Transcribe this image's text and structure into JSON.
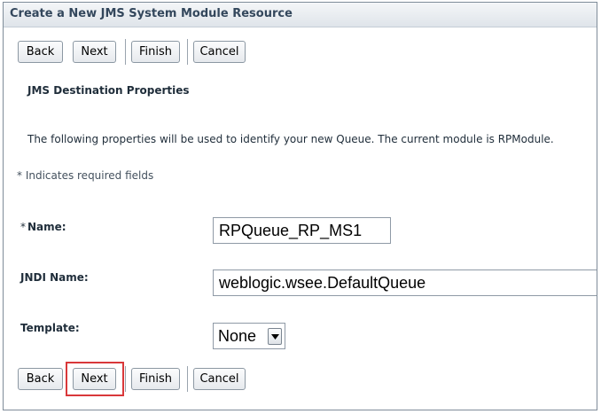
{
  "title": "Create a New JMS System Module Resource",
  "toolbar_top": {
    "back_label": "Back",
    "next_label": "Next",
    "finish_label": "Finish",
    "cancel_label": "Cancel"
  },
  "section": {
    "heading": "JMS Destination Properties",
    "intro": "The following properties will be used to identify your new Queue. The current module is RPModule.",
    "required_note": "* Indicates required fields"
  },
  "fields": {
    "name": {
      "required_mark": "*",
      "label": "Name:",
      "value": "RPQueue_RP_MS1"
    },
    "jndi": {
      "label": "JNDI Name:",
      "value": "weblogic.wsee.DefaultQueue"
    },
    "template": {
      "label": "Template:",
      "value": "None"
    }
  },
  "toolbar_bottom": {
    "back_label": "Back",
    "next_label": "Next",
    "finish_label": "Finish",
    "cancel_label": "Cancel"
  },
  "highlight": {
    "target": "next-button-bottom",
    "color": "#d9383a"
  },
  "icons": {
    "dropdown": "chevron-down-icon"
  }
}
